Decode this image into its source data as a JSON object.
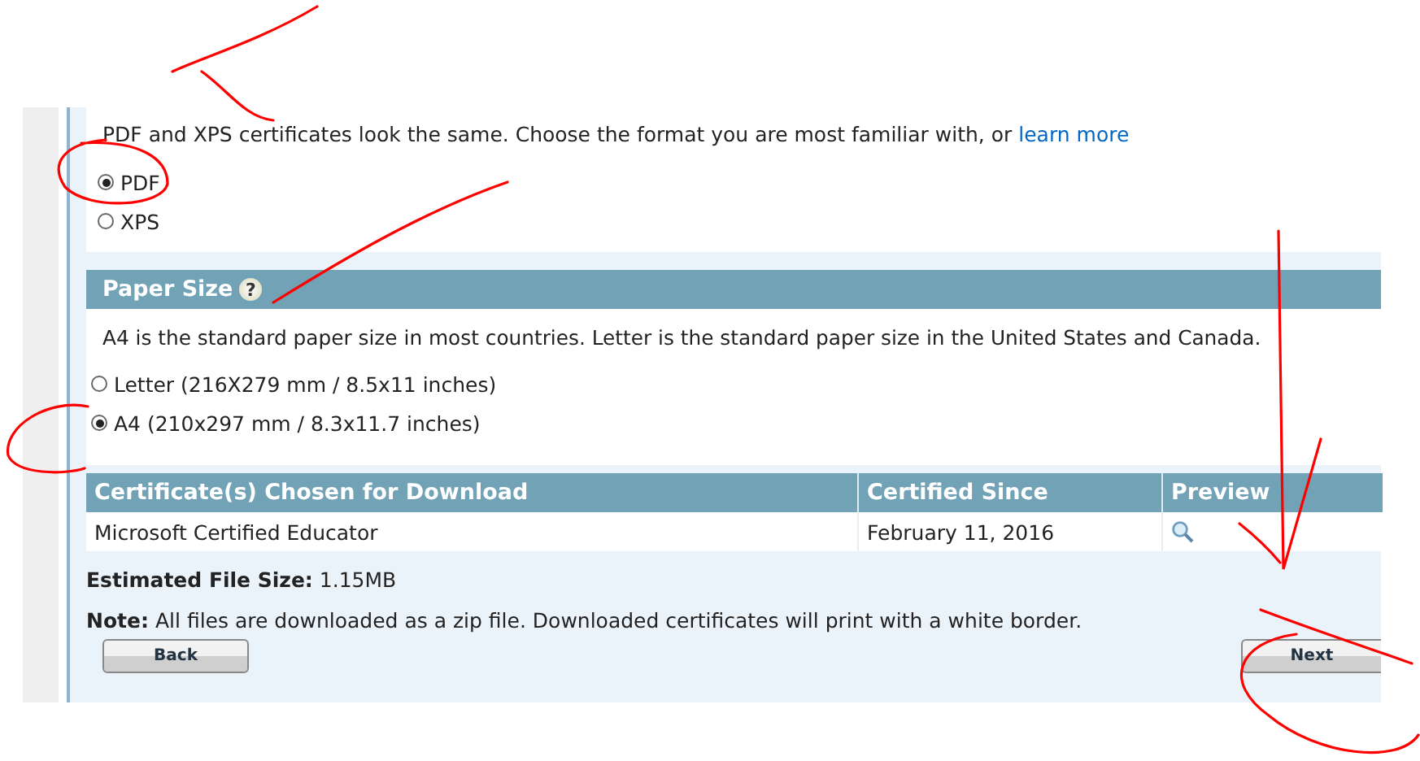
{
  "format": {
    "intro": "PDF and XPS certificates look the same. Choose the format you are most familiar with, or",
    "link": "learn more",
    "options": [
      {
        "label": "PDF",
        "selected": true
      },
      {
        "label": "XPS",
        "selected": false
      }
    ]
  },
  "paper_size": {
    "title": "Paper Size",
    "help": "?",
    "description": "A4 is the standard paper size in most countries. Letter is the standard paper size in the United States and Canada.",
    "options": [
      {
        "label": "Letter (216X279 mm / 8.5x11 inches)",
        "selected": false
      },
      {
        "label": "A4 (210x297 mm / 8.3x11.7 inches)",
        "selected": true
      }
    ]
  },
  "table": {
    "columns": [
      "Certificate(s) Chosen for Download",
      "Certified Since",
      "Preview"
    ],
    "rows": [
      {
        "name": "Microsoft Certified Educator",
        "since": "February 11, 2016"
      }
    ]
  },
  "file_size": {
    "label": "Estimated File Size:",
    "value": "1.15MB"
  },
  "note": "**Note:** All files are downloaded as a zip file. Downloaded certificates will print with a white border.",
  "buttons": [
    "Back",
    "Next"
  ]
}
